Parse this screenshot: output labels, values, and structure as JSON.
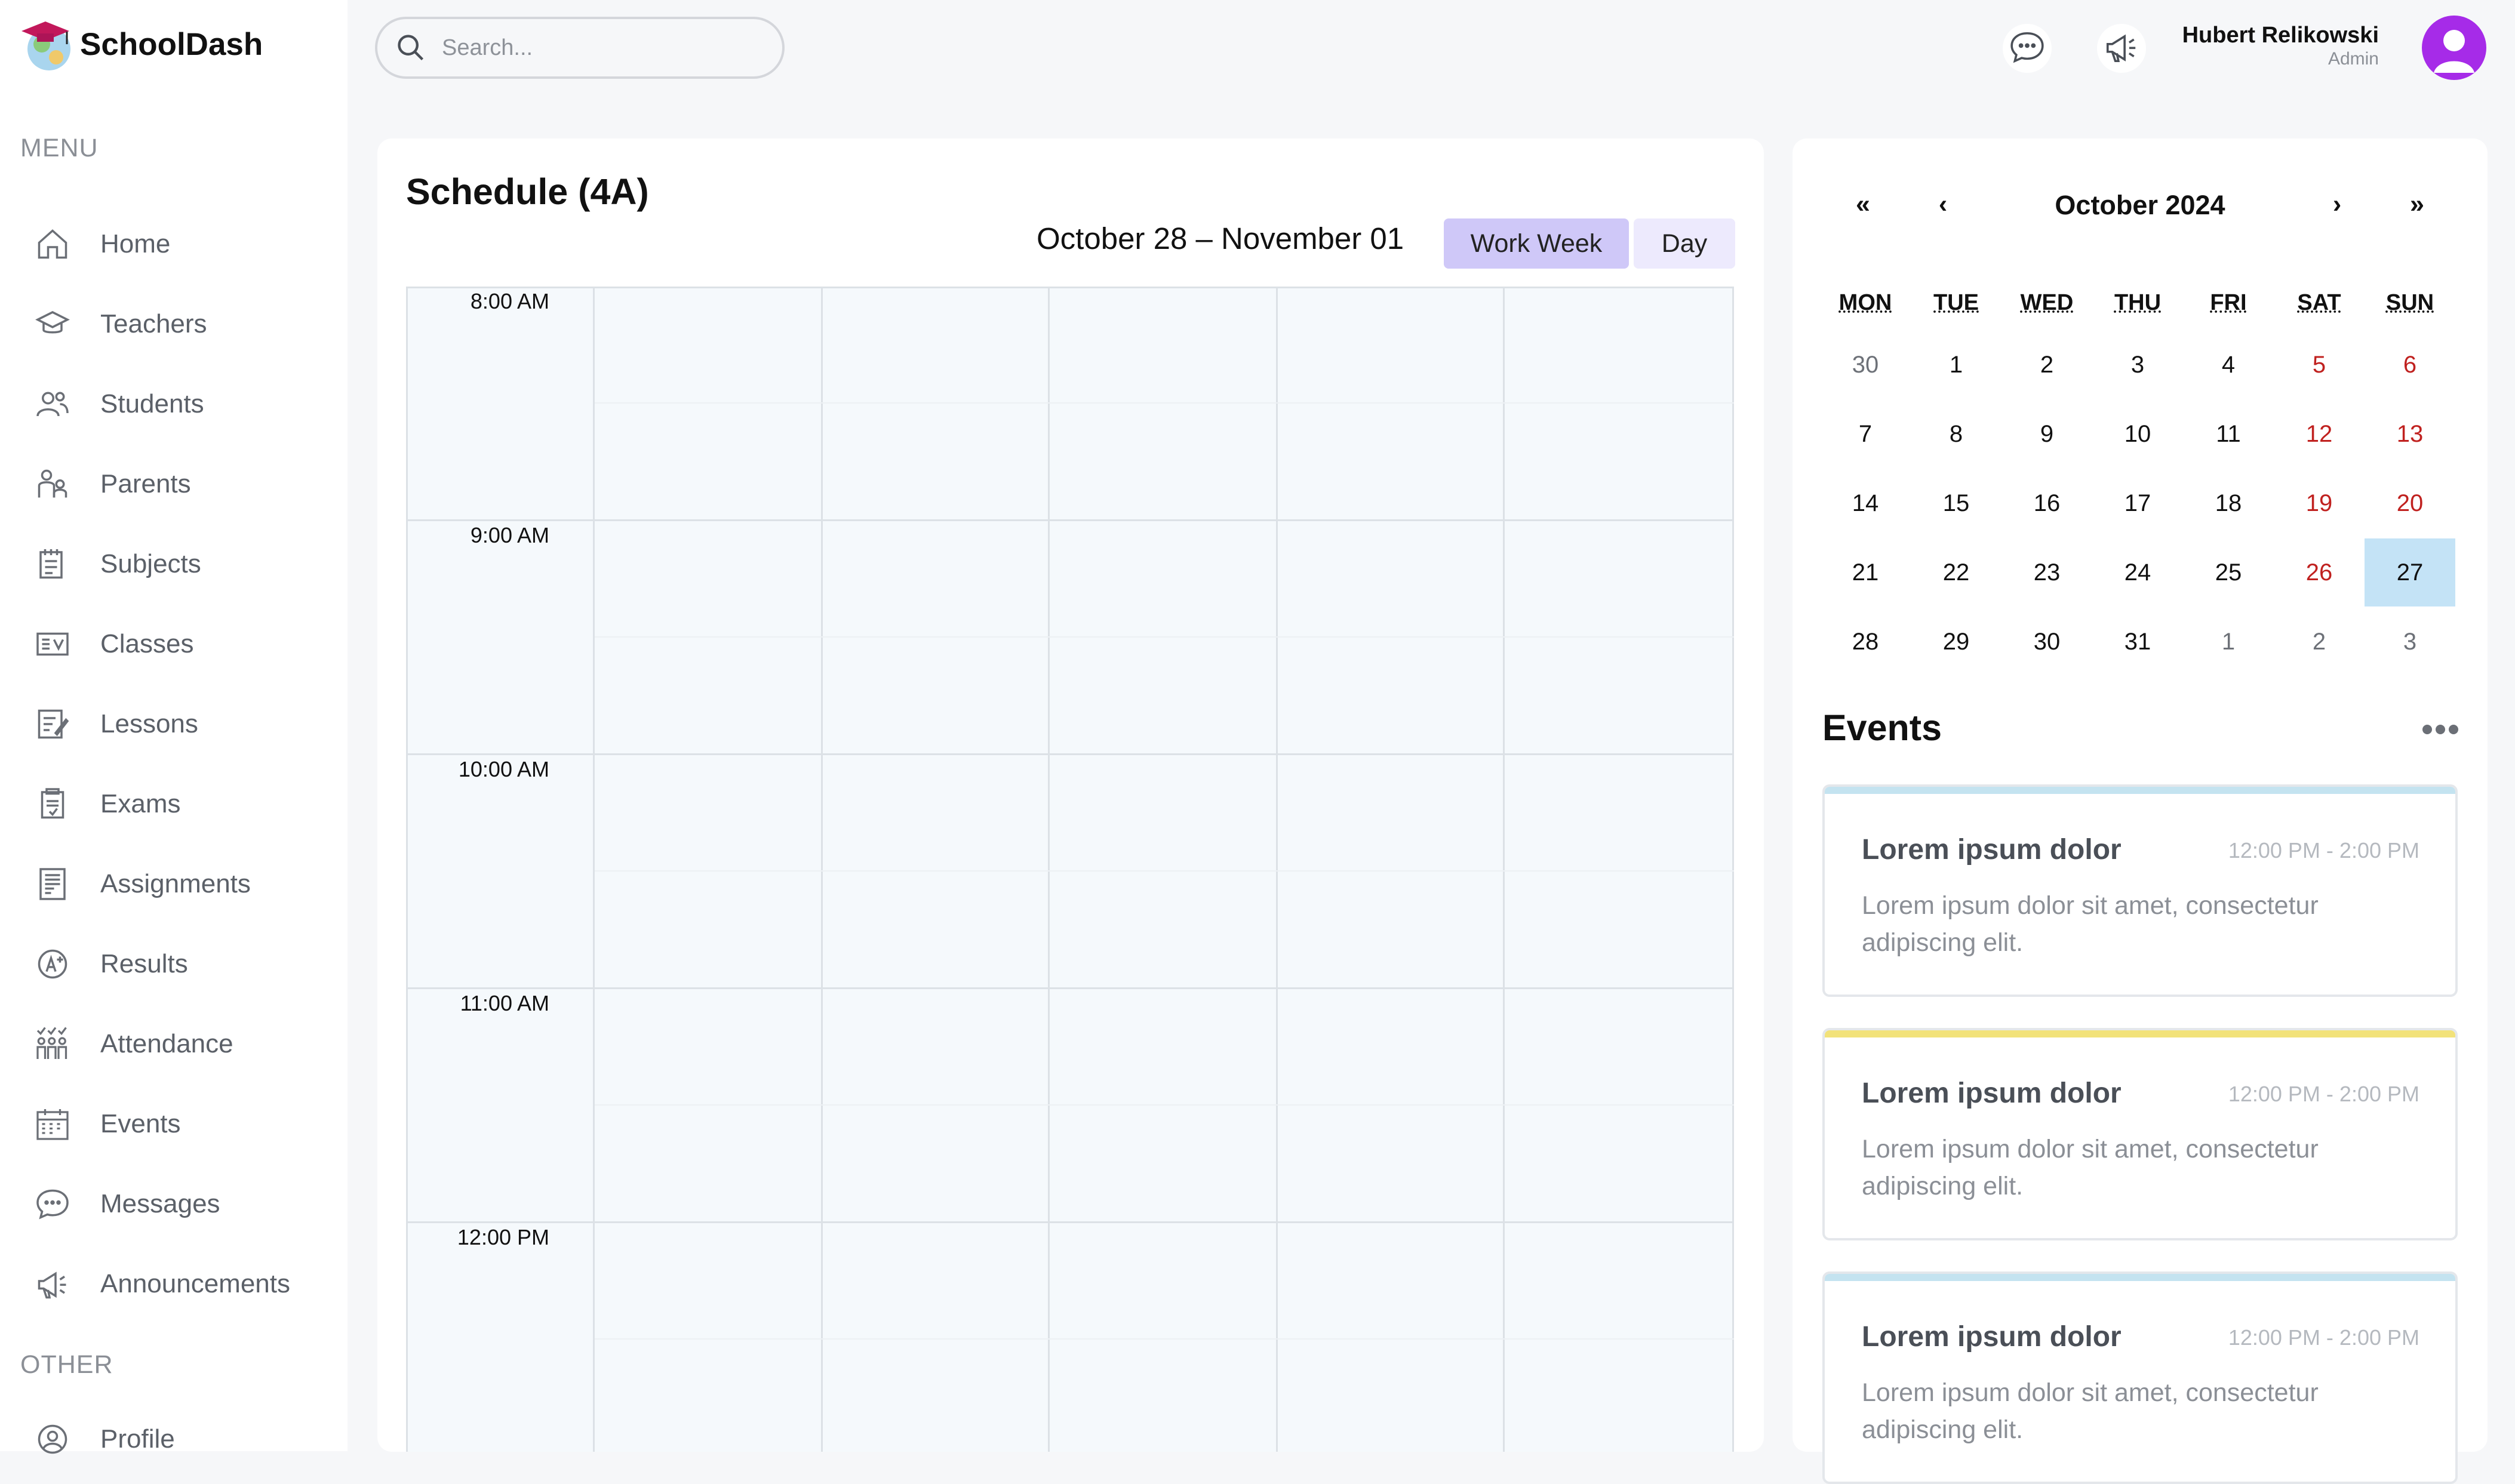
{
  "app": {
    "name": "SchoolDash"
  },
  "sidebar": {
    "menu_label": "MENU",
    "other_label": "OTHER",
    "items": [
      {
        "label": "Home",
        "icon": "home-icon"
      },
      {
        "label": "Teachers",
        "icon": "graduation-cap-icon"
      },
      {
        "label": "Students",
        "icon": "users-icon"
      },
      {
        "label": "Parents",
        "icon": "parents-icon"
      },
      {
        "label": "Subjects",
        "icon": "subjects-icon"
      },
      {
        "label": "Classes",
        "icon": "classes-icon"
      },
      {
        "label": "Lessons",
        "icon": "lessons-icon"
      },
      {
        "label": "Exams",
        "icon": "exams-icon"
      },
      {
        "label": "Assignments",
        "icon": "assignments-icon"
      },
      {
        "label": "Results",
        "icon": "results-icon"
      },
      {
        "label": "Attendance",
        "icon": "attendance-icon"
      },
      {
        "label": "Events",
        "icon": "calendar-icon"
      },
      {
        "label": "Messages",
        "icon": "message-icon"
      },
      {
        "label": "Announcements",
        "icon": "megaphone-icon"
      }
    ],
    "other_items": [
      {
        "label": "Profile",
        "icon": "profile-icon"
      }
    ]
  },
  "topbar": {
    "search_placeholder": "Search...",
    "user_name": "Hubert Relikowski",
    "user_role": "Admin"
  },
  "schedule": {
    "title": "Schedule (4A)",
    "range": "October 28 – November 01",
    "views": [
      "Work Week",
      "Day"
    ],
    "active_view": "Work Week",
    "times": [
      "8:00 AM",
      "9:00 AM",
      "10:00 AM",
      "11:00 AM",
      "12:00 PM"
    ]
  },
  "calendar": {
    "month": "October 2024",
    "nav": {
      "prev_year": "«",
      "prev_month": "‹",
      "next_month": "›",
      "next_year": "»"
    },
    "weekdays": [
      "MON",
      "TUE",
      "WED",
      "THU",
      "FRI",
      "SAT",
      "SUN"
    ],
    "weeks": [
      [
        "30",
        "1",
        "2",
        "3",
        "4",
        "5",
        "6"
      ],
      [
        "7",
        "8",
        "9",
        "10",
        "11",
        "12",
        "13"
      ],
      [
        "14",
        "15",
        "16",
        "17",
        "18",
        "19",
        "20"
      ],
      [
        "21",
        "22",
        "23",
        "24",
        "25",
        "26",
        "27"
      ],
      [
        "28",
        "29",
        "30",
        "31",
        "1",
        "2",
        "3"
      ]
    ],
    "today": "27",
    "colors": {
      "weekend": "#C0211F",
      "muted": "#6D7178",
      "today_bg": "#C4E3F6"
    }
  },
  "events": {
    "title": "Events",
    "items": [
      {
        "title": "Lorem ipsum dolor",
        "time": "12:00 PM - 2:00 PM",
        "desc": "Lorem ipsum dolor sit amet, consectetur adipiscing elit.",
        "color": "#C4E3F0"
      },
      {
        "title": "Lorem ipsum dolor",
        "time": "12:00 PM - 2:00 PM",
        "desc": "Lorem ipsum dolor sit amet, consectetur adipiscing elit.",
        "color": "#F2E27A"
      },
      {
        "title": "Lorem ipsum dolor",
        "time": "12:00 PM - 2:00 PM",
        "desc": "Lorem ipsum dolor sit amet, consectetur adipiscing elit.",
        "color": "#C4E3F0"
      }
    ]
  }
}
